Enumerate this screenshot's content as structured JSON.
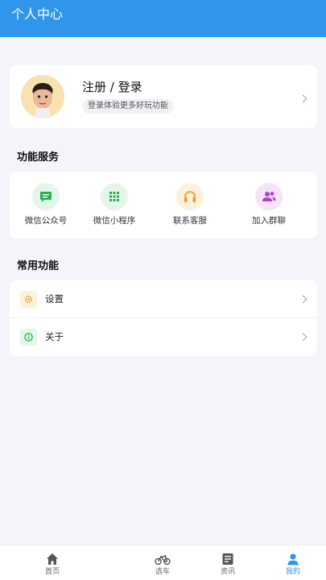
{
  "header": {
    "title": "个人中心"
  },
  "profile": {
    "login_text": "注册 / 登录",
    "subtitle": "登录体验更多好玩功能"
  },
  "services": {
    "title": "功能服务",
    "items": [
      {
        "label": "微信公众号",
        "icon": "wechat-message-icon",
        "color": "#23b44b"
      },
      {
        "label": "微信小程序",
        "icon": "apps-grid-icon",
        "color": "#23b44b"
      },
      {
        "label": "联系客服",
        "icon": "headset-icon",
        "color": "#f39b1c"
      },
      {
        "label": "加入群聊",
        "icon": "group-icon",
        "color": "#b13fd0"
      }
    ]
  },
  "common": {
    "title": "常用功能",
    "items": [
      {
        "label": "设置",
        "icon": "gear-icon",
        "color": "#f39b1c"
      },
      {
        "label": "关于",
        "icon": "info-icon",
        "color": "#23b44b"
      }
    ]
  },
  "tabbar": {
    "items": [
      {
        "label": "首页",
        "icon": "home-icon",
        "active": false
      },
      {
        "label": "选车",
        "icon": "bicycle-icon",
        "active": false
      },
      {
        "label": "资讯",
        "icon": "news-icon",
        "active": false
      },
      {
        "label": "我的",
        "icon": "user-icon",
        "active": true
      }
    ],
    "active_color": "#2f96ec"
  }
}
